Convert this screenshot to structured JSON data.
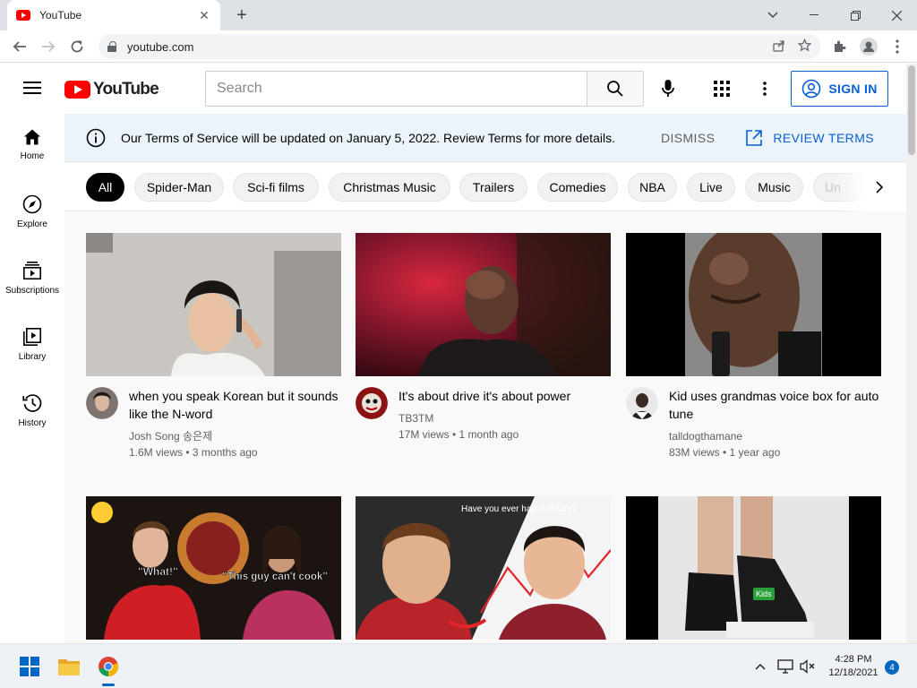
{
  "browser": {
    "tab_title": "YouTube",
    "url": "youtube.com"
  },
  "masthead": {
    "logo_text": "YouTube",
    "search_placeholder": "Search",
    "signin_label": "SIGN IN"
  },
  "guide": {
    "items": [
      {
        "label": "Home",
        "icon": "home-icon"
      },
      {
        "label": "Explore",
        "icon": "compass-icon"
      },
      {
        "label": "Subscriptions",
        "icon": "subscriptions-icon"
      },
      {
        "label": "Library",
        "icon": "library-icon"
      },
      {
        "label": "History",
        "icon": "history-icon"
      }
    ]
  },
  "banner": {
    "text": "Our Terms of Service will be updated on January 5, 2022. Review Terms for more details.",
    "dismiss": "DISMISS",
    "review": "REVIEW TERMS"
  },
  "chips": [
    "All",
    "Spider-Man",
    "Sci-fi films",
    "Christmas Music",
    "Trailers",
    "Comedies",
    "NBA",
    "Live",
    "Music",
    "Un"
  ],
  "videos": [
    {
      "title": "when you speak Korean but it sounds like the N-word",
      "channel": "Josh Song 송은제",
      "stats": "1.6M views • 3 months ago"
    },
    {
      "title": "It's about drive it's about power",
      "channel": "TB3TM",
      "stats": "17M views • 1 month ago"
    },
    {
      "title": "Kid uses grandmas voice box for auto tune",
      "channel": "talldogthamane",
      "stats": "83M views • 1 year ago"
    }
  ],
  "thumb_text": {
    "what": "\"What!\"",
    "cook": "\"This guy can't cook\"",
    "dream": "Have you ever had a dream?",
    "kids": "Kids"
  },
  "taskbar": {
    "time": "4:28 PM",
    "date": "12/18/2021",
    "notifications": "4"
  },
  "colors": {
    "accent_blue": "#065fd4",
    "yt_red": "#ff0000",
    "banner_bg": "#ecf4fb"
  }
}
